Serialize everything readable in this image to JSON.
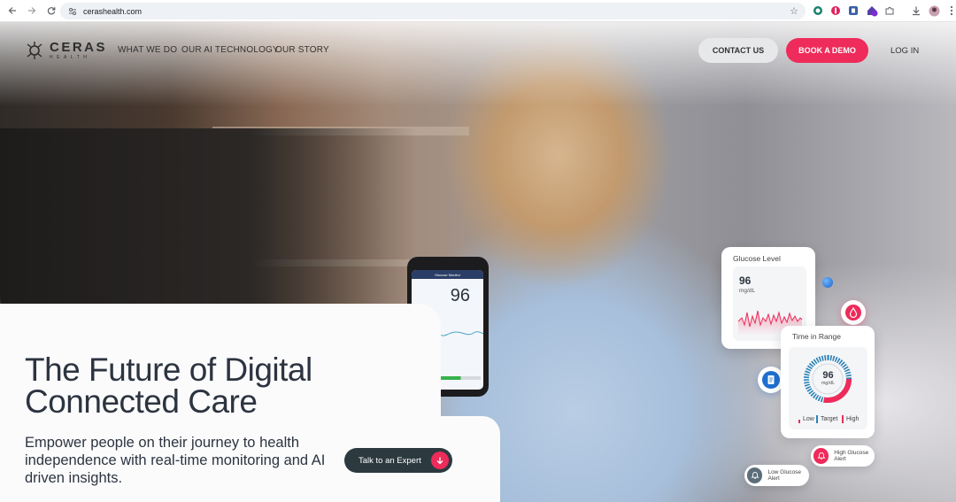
{
  "browser": {
    "url": "cerashealth.com",
    "icons": [
      "back-icon",
      "forward-icon",
      "reload-icon",
      "site-settings-icon",
      "bookmark-star-icon",
      "extension-icon",
      "download-icon",
      "menu-icon"
    ]
  },
  "brand": {
    "name": "CERAS",
    "sub": "HEALTH",
    "accent": "#ee2b5a",
    "dark": "#2c3440"
  },
  "nav": {
    "items": [
      "WHAT WE DO",
      "OUR AI TECHNOLOGY",
      "OUR STORY"
    ],
    "contact": "CONTACT US",
    "demo": "BOOK A DEMO",
    "login": "LOG IN"
  },
  "hero": {
    "headline_line1": "The Future of Digital",
    "headline_line2": "Connected Care",
    "subtext": "Empower people on their journey to health independence with real-time monitoring and AI driven insights.",
    "cta": "Talk to an Expert"
  },
  "phone": {
    "app_title": "Glucose Monitor",
    "value": "96"
  },
  "glucose_card": {
    "title": "Glucose Level",
    "value": "96",
    "unit": "mg/dL"
  },
  "range_card": {
    "title": "Time in Range",
    "value": "96",
    "unit": "mg/dL",
    "legend": {
      "low": "Low",
      "target": "Target",
      "high": "High"
    }
  },
  "alerts": {
    "high": "High Glucose Alert",
    "low": "Low Glucose Alert"
  }
}
